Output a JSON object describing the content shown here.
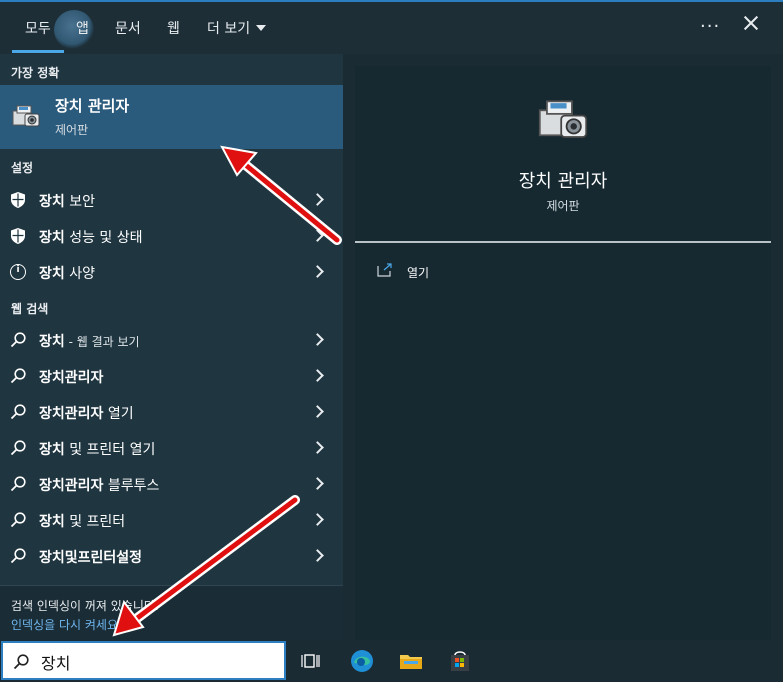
{
  "tabs": [
    {
      "label": "모두",
      "active": true
    },
    {
      "label": "앱"
    },
    {
      "label": "문서"
    },
    {
      "label": "웹"
    },
    {
      "label": "더 보기"
    }
  ],
  "sections": {
    "best_match": "가장 정확",
    "settings": "설정",
    "web_search": "웹 검색"
  },
  "best_match": {
    "title": "장치 관리자",
    "subtitle": "제어판"
  },
  "settings_items": [
    {
      "bold": "장치",
      "rest": " 보안"
    },
    {
      "bold": "장치",
      "rest": " 성능 및 상태"
    },
    {
      "bold": "장치",
      "rest": " 사양"
    }
  ],
  "web_items": [
    {
      "bold": "장치",
      "rest": " - 웹 결과 보기"
    },
    {
      "bold": "장치관리자",
      "rest": ""
    },
    {
      "bold": "장치관리자",
      "rest": " 열기"
    },
    {
      "bold": "장치",
      "rest": " 및 프린터 열기"
    },
    {
      "bold": "장치관리자",
      "rest": " 블루투스"
    },
    {
      "bold": "장치",
      "rest": " 및 프린터"
    },
    {
      "bold": "장치및프린터설정",
      "rest": ""
    }
  ],
  "footer": {
    "message": "검색 인덱싱이 꺼져 있습니다.",
    "link": "인덱싱을 다시 켜세요."
  },
  "preview": {
    "title": "장치 관리자",
    "subtitle": "제어판",
    "open_label": "열기"
  },
  "search": {
    "value": "장치"
  },
  "colors": {
    "accent": "#4aa8e8",
    "selected": "#2a5a7c",
    "arrow": "#e01010",
    "link": "#6fb6ef"
  }
}
